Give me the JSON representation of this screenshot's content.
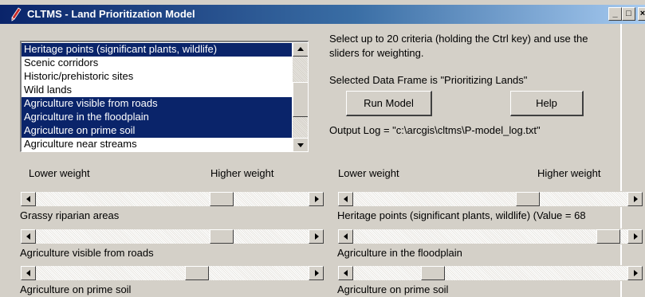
{
  "window": {
    "title": "CLTMS - Land Prioritization Model",
    "minimize_label": "_",
    "maximize_label": "□",
    "close_label": "×",
    "icon": "app-pen-icon"
  },
  "criteria_list": {
    "items": [
      {
        "label": "Heritage points (significant plants, wildlife)",
        "selected": true
      },
      {
        "label": "Scenic corridors",
        "selected": false
      },
      {
        "label": "Historic/prehistoric sites",
        "selected": false
      },
      {
        "label": "Wild lands",
        "selected": false
      },
      {
        "label": "Agriculture visible from roads",
        "selected": true
      },
      {
        "label": "Agriculture in the floodplain",
        "selected": true
      },
      {
        "label": "Agriculture on prime soil",
        "selected": true
      },
      {
        "label": "Agriculture near streams",
        "selected": false
      }
    ],
    "scroll_position": 0.55
  },
  "info": {
    "instruction_line1": "Select up to 20 criteria (holding the Ctrl key) and use the",
    "instruction_line2": "sliders for weighting.",
    "data_frame": "Selected Data Frame is \"Prioritizing Lands\"",
    "output_log": "Output Log = \"c:\\arcgis\\cltms\\P-model_log.txt\""
  },
  "buttons": {
    "run_model": "Run Model",
    "help": "Help"
  },
  "weights": {
    "left": {
      "lower": "Lower weight",
      "higher": "Higher weight"
    },
    "right": {
      "lower": "Lower weight",
      "higher": "Higher weight"
    }
  },
  "sliders": {
    "left": [
      {
        "label": "Grassy riparian areas",
        "position": 0.7
      },
      {
        "label": "Agriculture visible from roads",
        "position": 0.7
      },
      {
        "label": "Agriculture on prime soil",
        "position": 0.6
      }
    ],
    "right": [
      {
        "label": "Heritage points (significant plants, wildlife) (Value =  68",
        "position": 0.65
      },
      {
        "label": "Agriculture in the floodplain",
        "position": 0.97
      },
      {
        "label": "Agriculture on prime soil",
        "position": 0.27
      }
    ]
  },
  "colors": {
    "titlebar_start": "#0a246a",
    "titlebar_end": "#a6caf0",
    "selection": "#0a246a",
    "face": "#d4d0c8"
  }
}
